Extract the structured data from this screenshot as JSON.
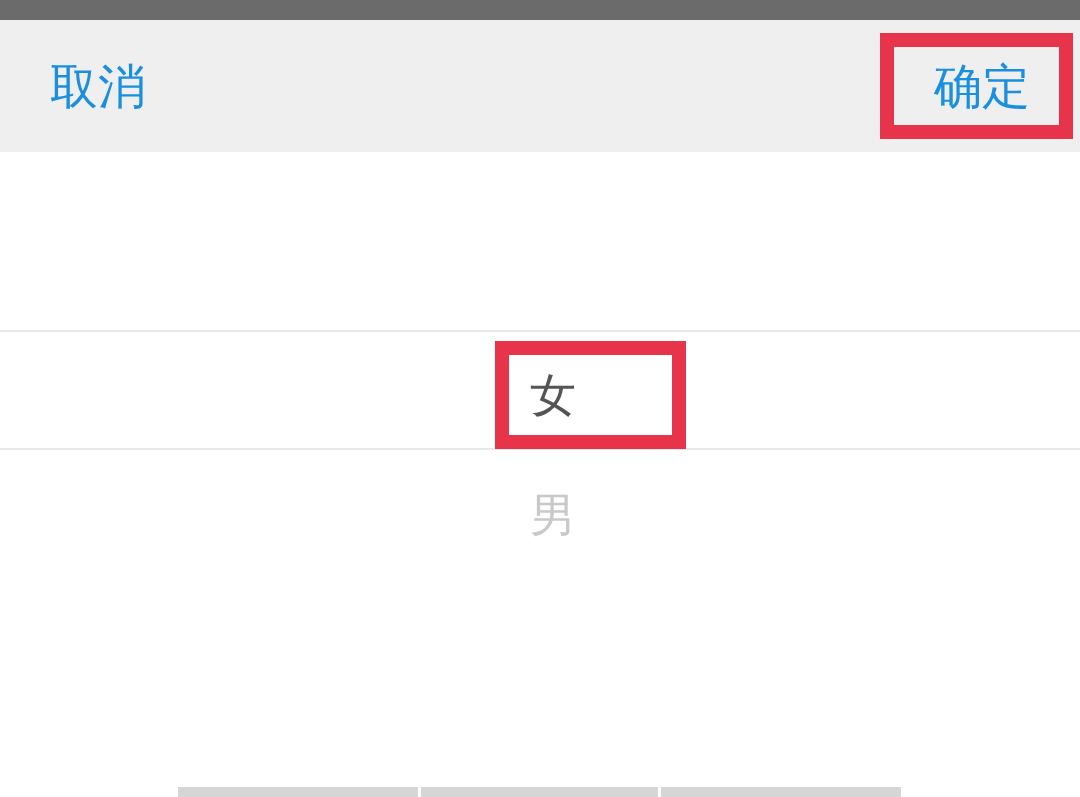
{
  "toolbar": {
    "cancel": {
      "label": "取消",
      "highlighted": false
    },
    "confirm": {
      "label": "确定",
      "highlighted": true
    }
  },
  "picker": {
    "options": [
      {
        "label": "女",
        "selected": true,
        "highlighted": true
      },
      {
        "label": "男",
        "selected": false,
        "highlighted": false
      }
    ]
  }
}
